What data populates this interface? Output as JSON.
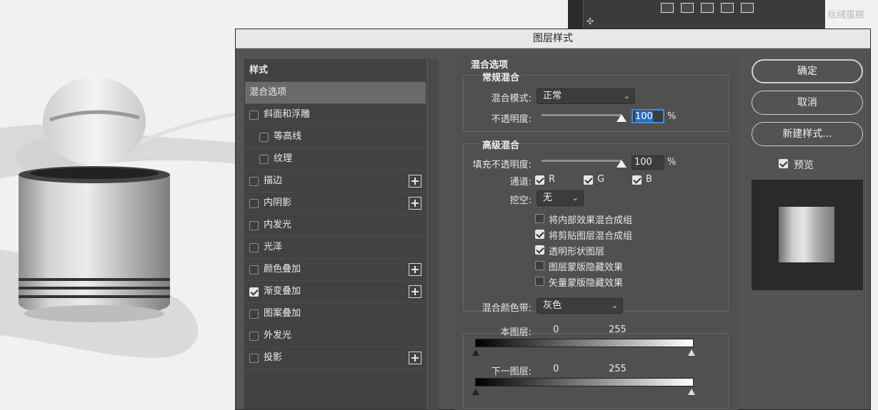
{
  "background": {
    "watermark": "丝绒蛋糕"
  },
  "dialog": {
    "title": "图层样式",
    "styles_header": "样式",
    "styles": [
      {
        "label": "混合选项",
        "checkbox": false,
        "checked": false,
        "plus": false,
        "indent": 0,
        "active": true
      },
      {
        "label": "斜面和浮雕",
        "checkbox": true,
        "checked": false,
        "plus": false,
        "indent": 0,
        "active": false
      },
      {
        "label": "等高线",
        "checkbox": true,
        "checked": false,
        "plus": false,
        "indent": 1,
        "active": false
      },
      {
        "label": "纹理",
        "checkbox": true,
        "checked": false,
        "plus": false,
        "indent": 1,
        "active": false
      },
      {
        "label": "描边",
        "checkbox": true,
        "checked": false,
        "plus": true,
        "indent": 0,
        "active": false
      },
      {
        "label": "内阴影",
        "checkbox": true,
        "checked": false,
        "plus": true,
        "indent": 0,
        "active": false
      },
      {
        "label": "内发光",
        "checkbox": true,
        "checked": false,
        "plus": false,
        "indent": 0,
        "active": false
      },
      {
        "label": "光泽",
        "checkbox": true,
        "checked": false,
        "plus": false,
        "indent": 0,
        "active": false
      },
      {
        "label": "颜色叠加",
        "checkbox": true,
        "checked": false,
        "plus": true,
        "indent": 0,
        "active": false
      },
      {
        "label": "渐变叠加",
        "checkbox": true,
        "checked": true,
        "plus": true,
        "indent": 0,
        "active": false
      },
      {
        "label": "图案叠加",
        "checkbox": true,
        "checked": false,
        "plus": false,
        "indent": 0,
        "active": false
      },
      {
        "label": "外发光",
        "checkbox": true,
        "checked": false,
        "plus": false,
        "indent": 0,
        "active": false
      },
      {
        "label": "投影",
        "checkbox": true,
        "checked": false,
        "plus": true,
        "indent": 0,
        "active": false
      }
    ],
    "blend_options": {
      "title": "混合选项",
      "general": {
        "title": "常规混合",
        "mode_label": "混合模式:",
        "mode_value": "正常",
        "opacity_label": "不透明度:",
        "opacity_value": "100",
        "opacity_unit": "%"
      },
      "advanced": {
        "title": "高级混合",
        "fill_label": "填充不透明度:",
        "fill_value": "100",
        "fill_unit": "%",
        "channels_label": "通道:",
        "channel_r": "R",
        "channel_g": "G",
        "channel_b": "B",
        "knockout_label": "挖空:",
        "knockout_value": "无",
        "options": [
          {
            "label": "将内部效果混合成组",
            "checked": false
          },
          {
            "label": "将剪贴图层混合成组",
            "checked": true
          },
          {
            "label": "透明形状图层",
            "checked": true
          },
          {
            "label": "图层蒙版隐藏效果",
            "checked": false
          },
          {
            "label": "矢量蒙版隐藏效果",
            "checked": false
          }
        ]
      },
      "blend_if": {
        "label": "混合颜色带:",
        "value": "灰色",
        "this_layer_label": "本图层:",
        "this_low": "0",
        "this_high": "255",
        "below_layer_label": "下一图层:",
        "below_low": "0",
        "below_high": "255"
      }
    },
    "buttons": {
      "ok": "确定",
      "cancel": "取消",
      "new_style": "新建样式..."
    },
    "preview_label": "预览",
    "preview_checked": true
  }
}
